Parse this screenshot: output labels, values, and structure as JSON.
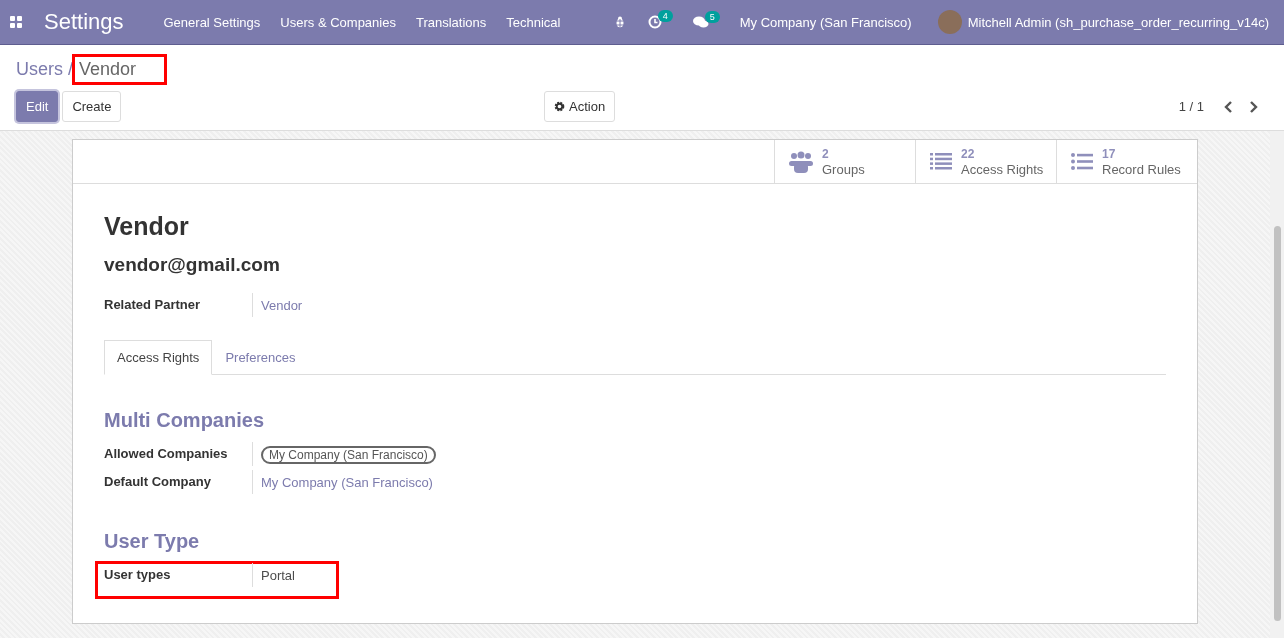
{
  "navbar": {
    "app_title": "Settings",
    "menu": [
      "General Settings",
      "Users & Companies",
      "Translations",
      "Technical"
    ],
    "activity_count": "4",
    "message_count": "5",
    "company": "My Company (San Francisco)",
    "user": "Mitchell Admin (sh_purchase_order_recurring_v14c)"
  },
  "breadcrumb": {
    "parent": "Users",
    "separator": "/",
    "current": "Vendor",
    "highlighted": true
  },
  "buttons": {
    "edit": "Edit",
    "create": "Create",
    "action": "Action"
  },
  "pager": {
    "value": "1 / 1"
  },
  "smart_buttons": [
    {
      "kind": "groups",
      "count": "2",
      "label": "Groups"
    },
    {
      "kind": "rights",
      "count": "22",
      "label": "Access Rights"
    },
    {
      "kind": "rules",
      "count": "17",
      "label": "Record Rules"
    }
  ],
  "record": {
    "name": "Vendor",
    "login": "vendor@gmail.com",
    "related_partner_label": "Related Partner",
    "related_partner": "Vendor"
  },
  "tabs": [
    {
      "label": "Access Rights",
      "selected": true
    },
    {
      "label": "Preferences",
      "selected": false
    }
  ],
  "sections": [
    {
      "title": "Multi Companies",
      "fields": [
        {
          "label": "Allowed Companies",
          "kind": "tag",
          "value": "My Company (San Francisco)",
          "highlighted": false
        },
        {
          "label": "Default Company",
          "kind": "link",
          "value": "My Company (San Francisco)",
          "highlighted": false
        }
      ]
    },
    {
      "title": "User Type",
      "fields": [
        {
          "label": "User types",
          "kind": "text",
          "value": "Portal",
          "highlighted": true
        }
      ]
    }
  ]
}
